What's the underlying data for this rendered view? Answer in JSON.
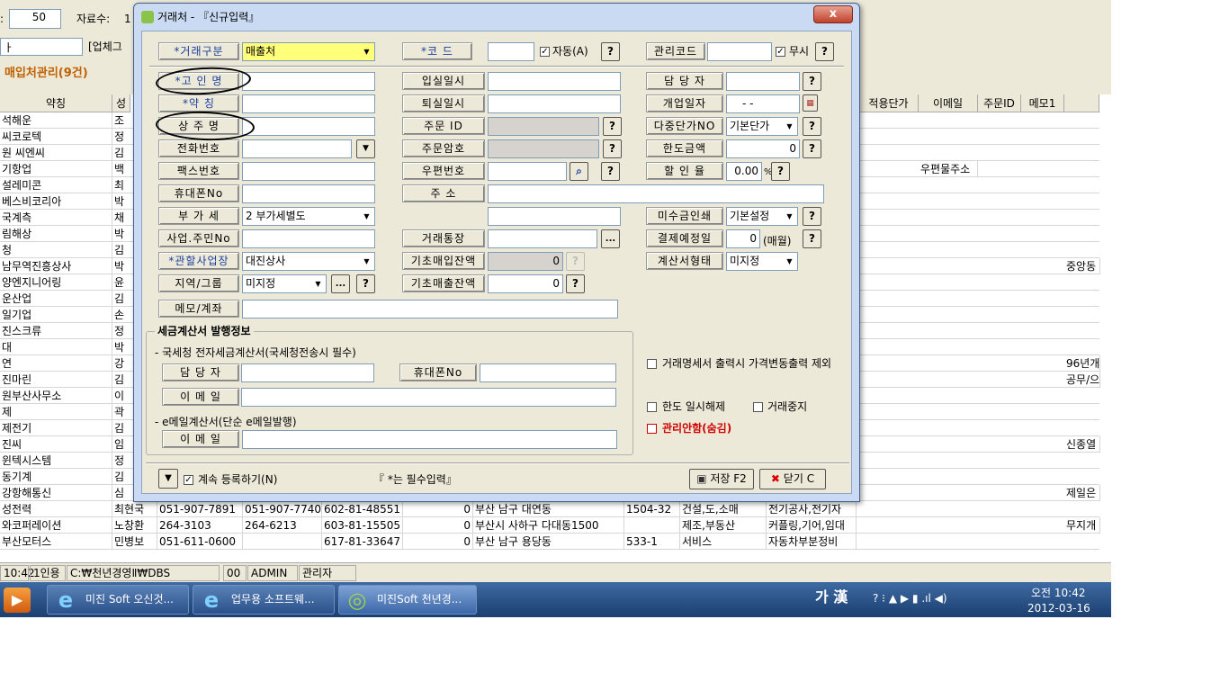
{
  "bg": {
    "filter_value": "50",
    "record_label": "자료수:",
    "record_val": "1",
    "combo_text": "ㅏ",
    "check_label": "[업체그",
    "section_title": "매입처관리(9건)",
    "colon": ":"
  },
  "grid": {
    "headers_left": [
      "약칭",
      "성"
    ],
    "headers_right": [
      "적용단가",
      "이메일",
      "주문ID",
      "메모1"
    ],
    "rows": [
      {
        "name": "석해운",
        "p": "조"
      },
      {
        "name": "씨코로텍",
        "p": "정"
      },
      {
        "name": "원 씨엔씨",
        "p": "김"
      },
      {
        "name": "기항업",
        "p": "백",
        "email": "우편물주소"
      },
      {
        "name": "설레미콘",
        "p": "최"
      },
      {
        "name": "베스비코리아",
        "p": "박"
      },
      {
        "name": "국계측",
        "p": "채"
      },
      {
        "name": "림해상",
        "p": "박"
      },
      {
        "name": "청",
        "p": "김"
      },
      {
        "name": "남무역진흥상사",
        "p": "박",
        "memo": "중앙동"
      },
      {
        "name": "양엔지니어링",
        "p": "윤"
      },
      {
        "name": "운산업",
        "p": "김"
      },
      {
        "name": "일기업",
        "p": "손"
      },
      {
        "name": "진스크류",
        "p": "정"
      },
      {
        "name": "대",
        "p": "박"
      },
      {
        "name": "연",
        "p": "강",
        "memo": "96년개"
      },
      {
        "name": "진마린",
        "p": "김",
        "memo": "공무/으"
      },
      {
        "name": "원부산사무소",
        "p": "이"
      },
      {
        "name": "제",
        "p": "곽"
      },
      {
        "name": "제전기",
        "p": "김"
      },
      {
        "name": "진씨",
        "p": "임",
        "memo": "신종열"
      },
      {
        "name": "윈텍시스템",
        "p": "정"
      },
      {
        "name": "동기계",
        "p": "김"
      },
      {
        "name": "강항해통신",
        "p": "심",
        "memo": "제일은"
      },
      {
        "name": "성전력",
        "p": "최현국",
        "tel": "051-907-7891",
        "fax": "051-907-7740",
        "biz": "602-81-48551",
        "n": "0",
        "addr": "부산 남구 대연동",
        "zip": "1504-32",
        "type": "건설,도,소매",
        "item": "전기공사,전기자"
      },
      {
        "name": "와코퍼레이션",
        "p": "노창환",
        "tel": "264-3103",
        "fax": "264-6213",
        "biz": "603-81-15505",
        "n": "0",
        "addr": "부산시 사하구 다대동1500",
        "zip": "",
        "type": "제조,부동산",
        "item": "커플링,기어,임대",
        "memo": "무지개"
      },
      {
        "name": "부산모터스",
        "p": "민병보",
        "tel": "051-611-0600",
        "fax": "",
        "biz": "617-81-33647",
        "n": "0",
        "addr": "부산 남구 용당동",
        "zip": "533-1",
        "type": "서비스",
        "item": "자동차부분정비"
      }
    ]
  },
  "status": {
    "time": "10:42",
    "mode": "1인용",
    "path": "C:₩천년경영Ⅱ₩DBS",
    "code": "00",
    "user": "ADMIN",
    "role": "관리자"
  },
  "taskbar": {
    "tasks": [
      "미진 Soft 오신것...",
      "업무용 소프트웨...",
      "미진Soft 천년경..."
    ],
    "ime": "가 漢",
    "clock_time": "오전 10:42",
    "clock_date": "2012-03-16"
  },
  "dialog": {
    "title": "거래처 - 『신규입력』",
    "close": "x",
    "labels": {
      "trade_type": "*거래구분",
      "code": "*코    드",
      "mgmt_code": "관리코드",
      "gokyeong": "*고 인 명",
      "short": "*약   칭",
      "owner": "상 주 명",
      "phone": "전화번호",
      "fax": "팩스번호",
      "mobile": "휴대폰No",
      "vat": "부 가 세",
      "bizno": "사업.주민No",
      "branch": "*관할사업장",
      "region": "지역/그룹",
      "memo": "메모/계좌",
      "in_date": "입실일시",
      "out_date": "퇴실일시",
      "order_id": "주문  ID",
      "order_pw": "주문암호",
      "zip": "우편번호",
      "addr": "주    소",
      "bank": "거래통장",
      "init_buy": "기초매입잔액",
      "init_sale": "기초매출잔액",
      "manager": "담 당 자",
      "open_date": "개업일자",
      "multi_price": "다중단가NO",
      "limit": "한도금액",
      "discount": "할 인 율",
      "unpaid_print": "미수금인쇄",
      "pay_day": "결제예정일",
      "invoice_type": "계산서형태"
    },
    "values": {
      "trade_type": "매출처",
      "auto_label": "자동(A)",
      "ignore_label": "무시",
      "date_blank": "-   -",
      "multi_price": "기본단가",
      "limit": "0",
      "discount": "0.00",
      "percent": "%",
      "vat": "2 부가세별도",
      "branch": "대진상사",
      "region": "미지정",
      "init_buy": "0",
      "init_sale": "0",
      "unpaid_print": "기본설정",
      "pay_day": "0",
      "monthly": "(매월)",
      "invoice_type": "미지정"
    },
    "tax_section": {
      "title": "세금계산서 발행정보",
      "nts_label": "- 국세청 전자세금계산서(국세청전송시 필수)",
      "manager": "담 당 자",
      "mobile": "휴대폰No",
      "email": "이 메 일",
      "simple_label": "- e메일계산서(단순 e메일발행)",
      "email2": "이 메 일"
    },
    "checks": {
      "price_exclude": "거래명세서 출력시 가격변동출력 제외",
      "limit_release": "한도 일시해제",
      "trade_stop": "거래중지",
      "hide": "관리안함(숨김)"
    },
    "footer": {
      "continue": "계속 등록하기(N)",
      "required_note": "『 *는 필수입력』",
      "save": "저장 F2",
      "close": "닫기 C"
    },
    "q": "?",
    "dots": "...",
    "arrow": "▼",
    "check": "✓"
  }
}
